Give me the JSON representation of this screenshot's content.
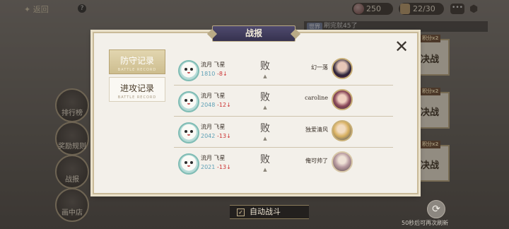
{
  "topbar": {
    "label": "返回",
    "help_icon": "?",
    "coins": "250",
    "tickets": "22/30",
    "chat_icon": "•••"
  },
  "ticker": {
    "tag": "世界",
    "text": "刷完就45了"
  },
  "side_menu": [
    {
      "label": "排行榜",
      "icon": "trophy-icon"
    },
    {
      "label": "奖励规则",
      "icon": "scroll-icon"
    },
    {
      "label": "战报",
      "icon": "report-icon"
    },
    {
      "label": "画中店",
      "icon": "shop-icon"
    }
  ],
  "right_cards": [
    {
      "badge": "积分x2",
      "label": "决战"
    },
    {
      "badge": "积分x2",
      "label": "决战"
    },
    {
      "badge": "积分x2",
      "label": "决战"
    },
    {
      "badge": "积分x2",
      "label": "决战"
    }
  ],
  "bottom": {
    "auto_battle": "自动战斗",
    "refresh_hint": "50秒后可再次刷新"
  },
  "modal": {
    "title": "战报",
    "tabs": [
      {
        "label": "防守记录",
        "sub": "BATTLE RECORD",
        "active": true
      },
      {
        "label": "进攻记录",
        "sub": "BATTLE RECORD",
        "active": false
      }
    ],
    "records": [
      {
        "player": "流月 飞星",
        "score": "1810",
        "delta": "-8↓",
        "result": "败",
        "opponent": "幻一落"
      },
      {
        "player": "流月 飞星",
        "score": "2048",
        "delta": "-12↓",
        "result": "败",
        "opponent": "caroline"
      },
      {
        "player": "流月 飞星",
        "score": "2042",
        "delta": "-13↓",
        "result": "败",
        "opponent": "独爱清风"
      },
      {
        "player": "流月 飞星",
        "score": "2021",
        "delta": "-13↓",
        "result": "败",
        "opponent": "俺可帅了"
      }
    ]
  },
  "colors": {
    "modal_bg": "#f3f0ea",
    "title_bar": "#3f3a5c",
    "score": "#5fa0b6",
    "loss_delta": "#cc3333"
  }
}
